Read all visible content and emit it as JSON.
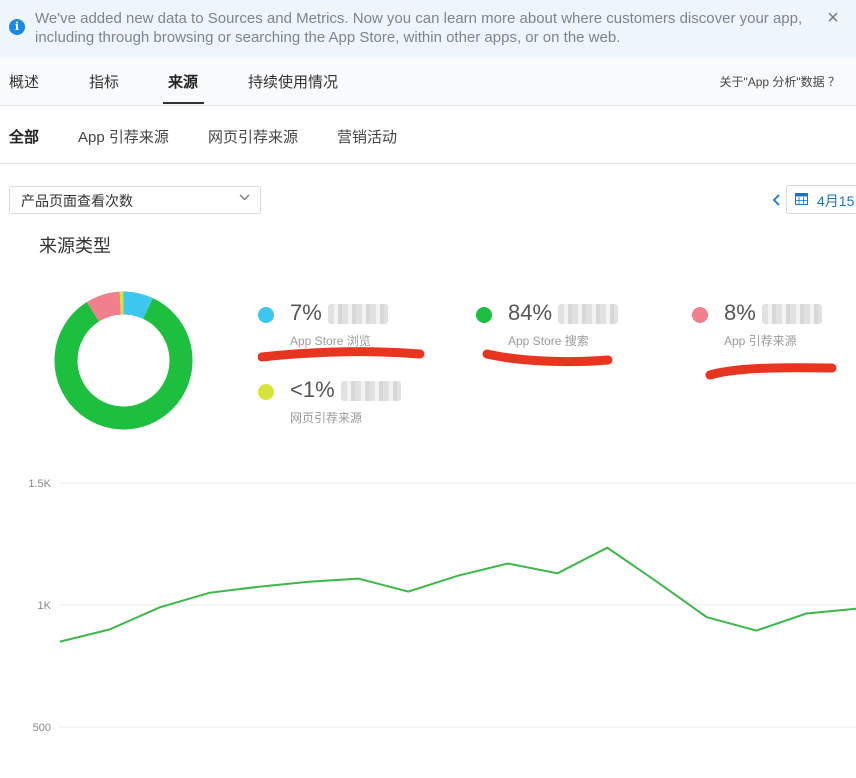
{
  "banner": {
    "text": "We've added new data to Sources and Metrics. Now you can learn more about where customers discover your app, including through browsing or searching the App Store, within other apps, or on the web.",
    "info_icon": "info-icon",
    "close_icon": "close-icon"
  },
  "tabs": [
    {
      "label": "概述"
    },
    {
      "label": "指标"
    },
    {
      "label": "来源"
    },
    {
      "label": "持续使用情况"
    }
  ],
  "active_tab": "来源",
  "about_label": "关于\"App 分析\"数据 ？",
  "subtabs": [
    {
      "label": "全部"
    },
    {
      "label": "App 引荐来源"
    },
    {
      "label": "网页引荐来源"
    },
    {
      "label": "营销活动"
    }
  ],
  "metric_select": {
    "value": "产品页面查看次数",
    "icon": "chevron-down-icon"
  },
  "date": {
    "label": "4月15",
    "icon": "calendar-icon",
    "prev_icon": "chevron-left-icon"
  },
  "source_types": {
    "title": "来源类型",
    "items": [
      {
        "pct": "7%",
        "label": "App Store 浏览",
        "color": "#3ec7ee"
      },
      {
        "pct": "84%",
        "label": "App Store 搜索",
        "color": "#1dbf3e"
      },
      {
        "pct": "8%",
        "label": "App 引荐来源",
        "color": "#f0808e"
      },
      {
        "pct": "<1%",
        "label": "网页引荐来源",
        "color": "#d8e23a"
      }
    ]
  },
  "chart_data": {
    "type": "line",
    "y_ticks": [
      "1.5K",
      "1K",
      "500"
    ],
    "ylim": [
      500,
      1500
    ],
    "grid": true,
    "series": [
      {
        "color": "#3cb84a",
        "values": [
          850,
          900,
          990,
          1050,
          1075,
          1095,
          1108,
          1055,
          1120,
          1170,
          1130,
          1235,
          1095,
          950,
          895,
          965,
          985
        ]
      }
    ]
  },
  "colors": {
    "accent": "#1a73c8",
    "annotation_red": "#e8351f"
  }
}
